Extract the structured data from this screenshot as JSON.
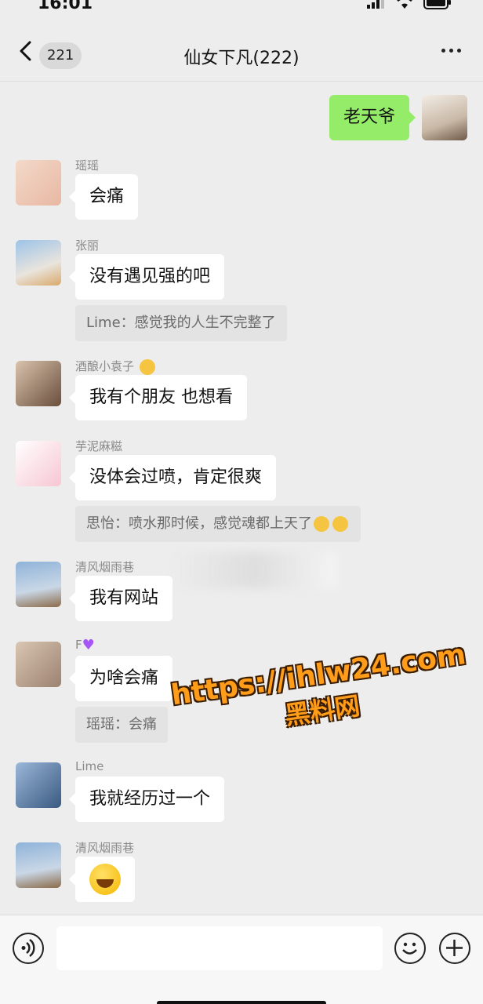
{
  "status": {
    "time": "16:01"
  },
  "nav": {
    "back_count": "221",
    "title": "仙女下凡(222)"
  },
  "messages": [
    {
      "sender": "",
      "text": "老天爷",
      "mine": true
    },
    {
      "sender": "瑶瑶",
      "text": "会痛"
    },
    {
      "sender": "张丽",
      "text": "没有遇见强的吧",
      "quote": "Lime：感觉我的人生不完整了"
    },
    {
      "sender": "酒酿小袁子",
      "text": "我有个朋友 也想看"
    },
    {
      "sender": "芋泥麻糍",
      "text": "没体会过喷，肯定很爽",
      "quote": "思怡：喷水那时候，感觉魂都上天了"
    },
    {
      "sender": "清风烟雨巷",
      "text": "我有网站"
    },
    {
      "sender": "F",
      "text": "为啥会痛",
      "quote": "瑶瑶：会痛"
    },
    {
      "sender": "Lime",
      "text": "我就经历过一个"
    },
    {
      "sender": "清风烟雨巷",
      "text": ""
    }
  ],
  "watermark": {
    "url": "https://ihlw24.com",
    "cn": "黑料网"
  },
  "icons": {
    "back": "chevron-left-icon",
    "more": "more-icon",
    "voice": "voice-icon",
    "emoji": "emoji-icon",
    "plus": "plus-icon"
  },
  "colors": {
    "bubble_mine": "#95ec69",
    "bubble_other": "#ffffff",
    "background": "#ededed",
    "watermark": "#ff9d1a"
  }
}
